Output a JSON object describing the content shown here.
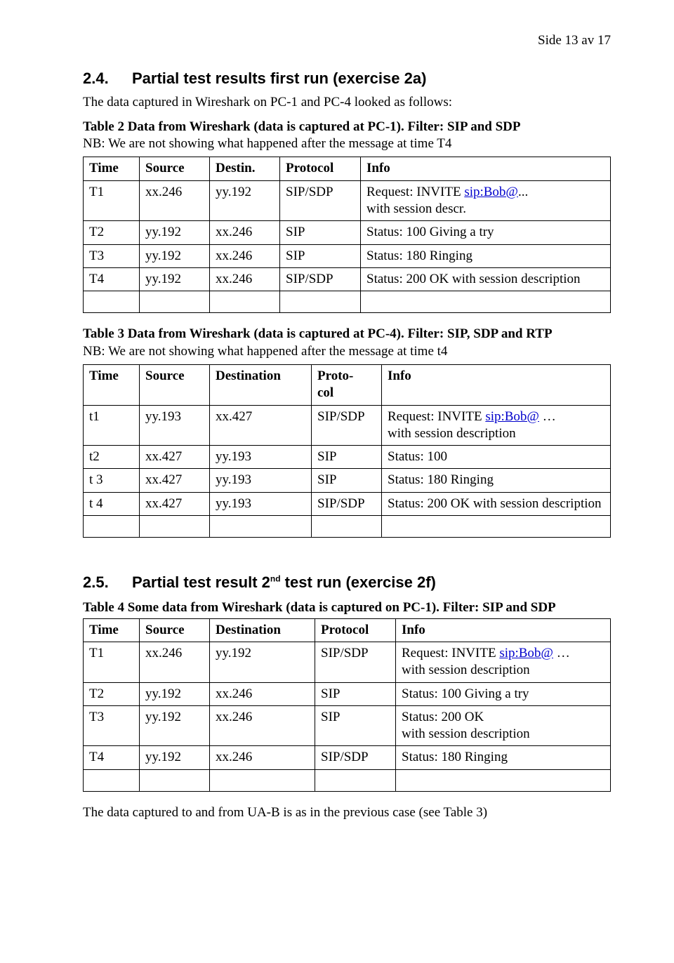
{
  "page_number": "Side 13 av 17",
  "s24": {
    "num": "2.4.",
    "title": "Partial test results first run (exercise 2a)",
    "intro": "The data captured in Wireshark on PC-1 and PC-4 looked as follows:",
    "t2cap": "Table 2 Data from Wireshark (data is captured at PC-1). Filter: SIP and SDP",
    "t2nb": "NB:  We are not showing what happened after the message at time T4",
    "t2": {
      "h": [
        "Time",
        "Source",
        "Destin.",
        "Protocol",
        "Info"
      ],
      "r1": {
        "c0": "T1",
        "c1": "xx.246",
        "c2": "yy.192",
        "c3": "SIP/SDP",
        "c4a": "Request: INVITE ",
        "link": "sip:Bob@",
        "c4b": "...",
        "c4c": "with session descr."
      },
      "r2": {
        "c0": "T2",
        "c1": "yy.192",
        "c2": "xx.246",
        "c3": "SIP",
        "c4": "Status: 100 Giving a try"
      },
      "r3": {
        "c0": "T3",
        "c1": "yy.192",
        "c2": "xx.246",
        "c3": "SIP",
        "c4": "Status: 180 Ringing"
      },
      "r4": {
        "c0": "T4",
        "c1": "yy.192",
        "c2": "xx.246",
        "c3": "SIP/SDP",
        "c4": "Status: 200 OK  with session description"
      }
    },
    "t3cap": "Table 3 Data from Wireshark (data is captured at PC-4). Filter: SIP, SDP and RTP",
    "t3nb": "NB: We are not showing what happened after the message at time t4",
    "t3": {
      "h": [
        "Time",
        "Source",
        "Destination",
        "Proto-",
        "col",
        "Info"
      ],
      "r1": {
        "c0": "t1",
        "c1": "yy.193",
        "c2": "xx.427",
        "c3": "SIP/SDP",
        "c4a": "Request: INVITE ",
        "link": "sip:Bob@",
        "c4b": " …",
        "c4c": "with session description"
      },
      "r2": {
        "c0": "t2",
        "c1": "xx.427",
        "c2": "yy.193",
        "c3": "SIP",
        "c4": "Status: 100"
      },
      "r3": {
        "c0": "t 3",
        "c1": "xx.427",
        "c2": "yy.193",
        "c3": "SIP",
        "c4": "Status: 180 Ringing"
      },
      "r4": {
        "c0": "t 4",
        "c1": "xx.427",
        "c2": "yy.193",
        "c3": "SIP/SDP",
        "c4": "Status: 200 OK with session description"
      }
    }
  },
  "s25": {
    "num": "2.5.",
    "title_a": "Partial test result 2",
    "title_sup": "nd",
    "title_b": " test run (exercise 2f)",
    "t4cap": "Table 4 Some data from Wireshark (data is captured on PC-1). Filter: SIP and  SDP",
    "t4": {
      "h": [
        "Time",
        "Source",
        "Destination",
        "Protocol",
        "Info"
      ],
      "r1": {
        "c0": "T1",
        "c1": "xx.246",
        "c2": "yy.192",
        "c3": "SIP/SDP",
        "c4a": "Request: INVITE ",
        "link": "sip:Bob@",
        "c4b": " …",
        "c4c": "with session description"
      },
      "r2": {
        "c0": "T2",
        "c1": "yy.192",
        "c2": "xx.246",
        "c3": "SIP",
        "c4": "Status: 100 Giving a try"
      },
      "r3": {
        "c0": "T3",
        "c1": "yy.192",
        "c2": "xx.246",
        "c3": "SIP",
        "c4a": "Status: 200 OK",
        "c4b": "with session description"
      },
      "r4": {
        "c0": "T4",
        "c1": "yy.192",
        "c2": "xx.246",
        "c3": "SIP/SDP",
        "c4": "Status: 180 Ringing"
      }
    }
  },
  "footnote": "The data captured to and from UA-B is as in the previous case (see Table 3)"
}
